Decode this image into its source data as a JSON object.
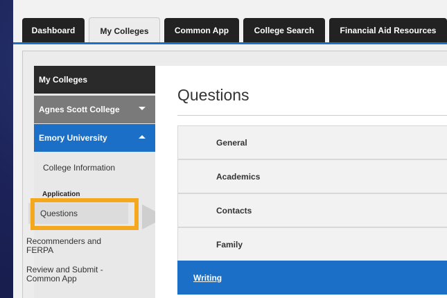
{
  "tabs": [
    {
      "label": "Dashboard"
    },
    {
      "label": "My Colleges",
      "active": true
    },
    {
      "label": "Common App"
    },
    {
      "label": "College Search"
    },
    {
      "label": "Financial Aid Resources"
    }
  ],
  "sidebar": {
    "header": "My Colleges",
    "college_collapsed": "Agnes Scott College",
    "college_expanded": "Emory University",
    "college_info": "College Information",
    "application_label": "Application",
    "items": [
      "Questions",
      "Recommenders and FERPA",
      "Review and Submit - Common App"
    ]
  },
  "main": {
    "title": "Questions",
    "sections": [
      "General",
      "Academics",
      "Contacts",
      "Family",
      "Writing"
    ],
    "active_section": "Writing"
  },
  "colors": {
    "accent": "#1c6fc6",
    "highlight": "#f4a81d",
    "tab_dark": "#222222",
    "sidebar_gray": "#7a7a7a"
  }
}
